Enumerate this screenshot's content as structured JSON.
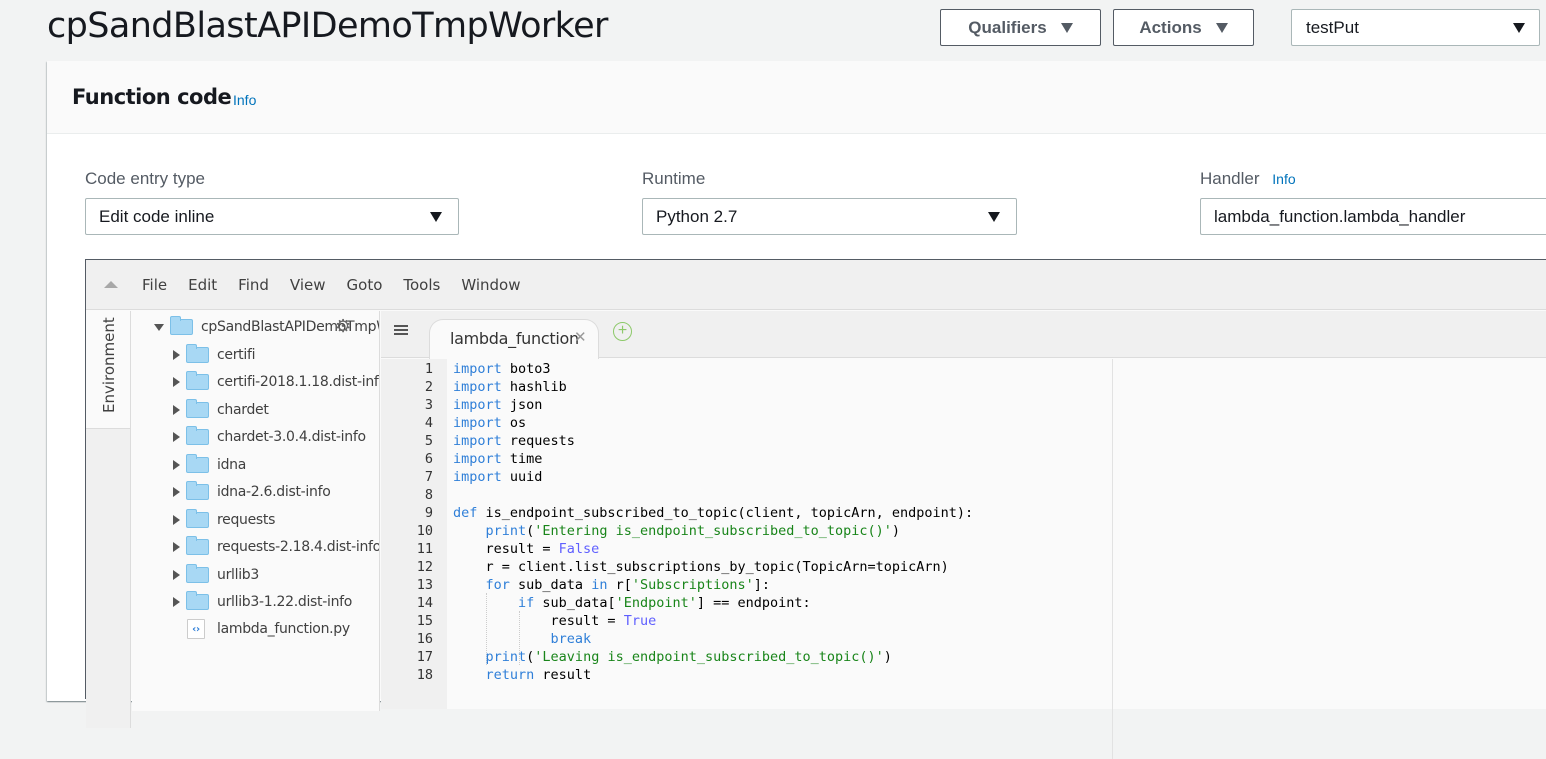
{
  "header": {
    "title": "cpSandBlastAPIDemoTmpWorker",
    "qualifiers_label": "Qualifiers",
    "actions_label": "Actions",
    "test_event_select": "testPut"
  },
  "function_code": {
    "title": "Function code",
    "info_label": "Info",
    "code_entry_type": {
      "label": "Code entry type",
      "value": "Edit code inline"
    },
    "runtime": {
      "label": "Runtime",
      "value": "Python 2.7"
    },
    "handler": {
      "label": "Handler",
      "info_label": "Info",
      "value": "lambda_function.lambda_handler"
    }
  },
  "editor": {
    "menu": [
      "File",
      "Edit",
      "Find",
      "View",
      "Goto",
      "Tools",
      "Window"
    ],
    "environment_tab": "Environment",
    "tree": {
      "root": "cpSandBlastAPIDemoTmpW",
      "folders": [
        "certifi",
        "certifi-2018.1.18.dist-info",
        "chardet",
        "chardet-3.0.4.dist-info",
        "idna",
        "idna-2.6.dist-info",
        "requests",
        "requests-2.18.4.dist-info",
        "urllib3",
        "urllib3-1.22.dist-info"
      ],
      "files": [
        "lambda_function.py"
      ]
    },
    "active_tab": "lambda_function",
    "line_numbers": [
      "1",
      "2",
      "3",
      "4",
      "5",
      "6",
      "7",
      "8",
      "9",
      "10",
      "11",
      "12",
      "13",
      "14",
      "15",
      "16",
      "17",
      "18"
    ],
    "code_lines": [
      "import boto3",
      "import hashlib",
      "import json",
      "import os",
      "import requests",
      "import time",
      "import uuid",
      "",
      "def is_endpoint_subscribed_to_topic(client, topicArn, endpoint):",
      "    print('Entering is_endpoint_subscribed_to_topic()')",
      "    result = False",
      "    r = client.list_subscriptions_by_topic(TopicArn=topicArn)",
      "    for sub_data in r['Subscriptions']:",
      "        if sub_data['Endpoint'] == endpoint:",
      "            result = True",
      "            break",
      "    print('Leaving is_endpoint_subscribed_to_topic()')",
      "    return result"
    ]
  },
  "colors": {
    "link": "#0073bb",
    "keyword": "#2f7fd8",
    "string": "#19851a",
    "constant": "#5f5fff"
  }
}
